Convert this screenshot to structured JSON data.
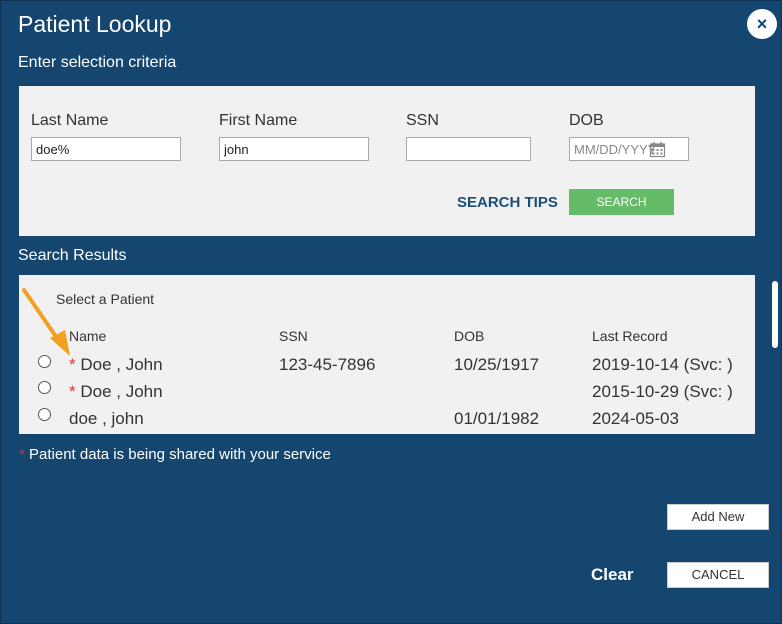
{
  "dialog": {
    "title": "Patient Lookup",
    "close_icon": "×",
    "criteria_heading": "Enter selection criteria"
  },
  "criteria": {
    "last_name": {
      "label": "Last Name",
      "value": "doe%"
    },
    "first_name": {
      "label": "First Name",
      "value": "john"
    },
    "ssn": {
      "label": "SSN",
      "value": ""
    },
    "dob": {
      "label": "DOB",
      "value": "",
      "placeholder": "MM/DD/YYYY"
    },
    "search_tips": "SEARCH TIPS",
    "search_button": "SEARCH"
  },
  "results": {
    "heading": "Search Results",
    "subheading": "Select a Patient",
    "columns": [
      "Name",
      "SSN",
      "DOB",
      "Last Record"
    ],
    "rows": [
      {
        "shared": true,
        "name": "Doe , John",
        "ssn": "123-45-7896",
        "dob": "10/25/1917",
        "last_record": "2019-10-14 (Svc: )"
      },
      {
        "shared": true,
        "name": "Doe , John",
        "ssn": "",
        "dob": "",
        "last_record": "2015-10-29 (Svc: )"
      },
      {
        "shared": false,
        "name": "doe , john",
        "ssn": "",
        "dob": "01/01/1982",
        "last_record": "2024-05-03"
      }
    ]
  },
  "footer": {
    "shared_marker": "*",
    "shared_note": "Patient data is being shared with your service",
    "add_new_button": "Add New",
    "clear_link": "Clear",
    "cancel_button": "CANCEL"
  },
  "colors": {
    "dialog_bg": "#15466f",
    "panel_bg": "#f1f1f1",
    "search_button": "#66bb66",
    "shared_star": "#dd3333",
    "annotation_arrow": "#f2a020"
  }
}
